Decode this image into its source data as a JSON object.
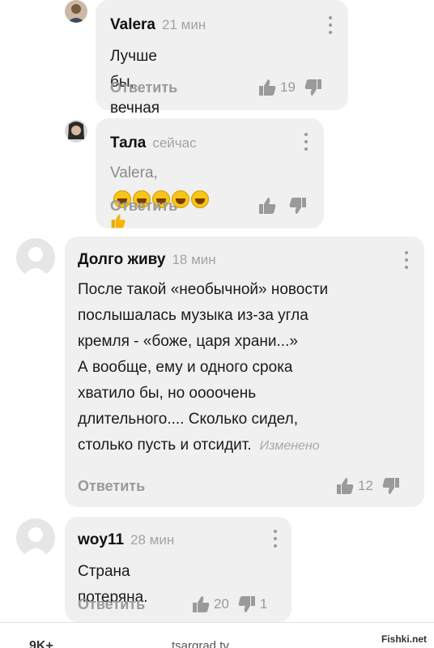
{
  "comments": [
    {
      "author": "Valera",
      "time": "21 мин",
      "text": "Лучше бы, вечная память",
      "reply_label": "Ответить",
      "likes": "19",
      "dislikes": ""
    },
    {
      "author": "Тала",
      "time": "сейчас",
      "mention": "Valera,",
      "emoji_description": "😆😆😆😆😆👍",
      "reply_label": "Ответить",
      "likes": "",
      "dislikes": ""
    },
    {
      "author": "Долго живу",
      "time": "18 мин",
      "text_lines": [
        "После такой «необычной» новости",
        "послышалась музыка из-за угла",
        "кремля - «боже, царя храни...»",
        "А вообще, ему и одного срока",
        "хватило бы, но оооочень",
        "длительного.... Сколько сидел,",
        "столько пусть и отсидит."
      ],
      "edited_label": "Изменено",
      "reply_label": "Ответить",
      "likes": "12",
      "dislikes": ""
    },
    {
      "author": "woy11",
      "time": "28 мин",
      "text": "Страна потеряна.",
      "reply_label": "Ответить",
      "likes": "20",
      "dislikes": "1"
    }
  ],
  "footer": {
    "left": "9K+",
    "mid": "tsargrad.tv"
  },
  "watermark": "Fishki.net",
  "colors": {
    "bubble": "#f0f0f0",
    "muted": "#9a9a9a"
  }
}
